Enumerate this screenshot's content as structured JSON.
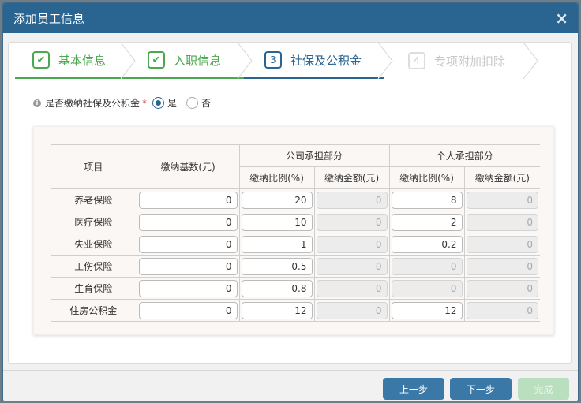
{
  "dialog": {
    "title": "添加员工信息",
    "close_glyph": "×"
  },
  "steps": [
    {
      "badge": "✔",
      "label": "基本信息",
      "state": "done"
    },
    {
      "badge": "✔",
      "label": "入职信息",
      "state": "done"
    },
    {
      "badge": "3",
      "label": "社保及公积金",
      "state": "active"
    },
    {
      "badge": "4",
      "label": "专项附加扣除",
      "state": "pending"
    }
  ],
  "question": {
    "info_glyph": "i",
    "text": "是否缴纳社保及公积金",
    "required_mark": "*",
    "options": [
      {
        "label": "是",
        "checked": true
      },
      {
        "label": "否",
        "checked": false
      }
    ]
  },
  "table": {
    "headers": {
      "item": "项目",
      "base": "缴纳基数(元)",
      "company_group": "公司承担部分",
      "personal_group": "个人承担部分",
      "company_rate": "缴纳比例(%)",
      "company_amount": "缴纳金额(元)",
      "personal_rate": "缴纳比例(%)",
      "personal_amount": "缴纳金额(元)"
    },
    "rows": [
      {
        "item": "养老保险",
        "base": "0",
        "company_rate": "20",
        "company_amount": "0",
        "personal_rate": "8",
        "personal_amount": "0",
        "personal_rate_readonly": false
      },
      {
        "item": "医疗保险",
        "base": "0",
        "company_rate": "10",
        "company_amount": "0",
        "personal_rate": "2",
        "personal_amount": "0",
        "personal_rate_readonly": false
      },
      {
        "item": "失业保险",
        "base": "0",
        "company_rate": "1",
        "company_amount": "0",
        "personal_rate": "0.2",
        "personal_amount": "0",
        "personal_rate_readonly": false
      },
      {
        "item": "工伤保险",
        "base": "0",
        "company_rate": "0.5",
        "company_amount": "0",
        "personal_rate": "0",
        "personal_amount": "0",
        "personal_rate_readonly": true
      },
      {
        "item": "生育保险",
        "base": "0",
        "company_rate": "0.8",
        "company_amount": "0",
        "personal_rate": "0",
        "personal_amount": "0",
        "personal_rate_readonly": true
      },
      {
        "item": "住房公积金",
        "base": "0",
        "company_rate": "12",
        "company_amount": "0",
        "personal_rate": "12",
        "personal_amount": "0",
        "personal_rate_readonly": false
      }
    ]
  },
  "footer": {
    "prev_label": "上一步",
    "next_label": "下一步",
    "finish_label": "完成"
  },
  "colors": {
    "primary": "#2a6592",
    "done": "#4aa84e",
    "finish_disabled": "#b9dfbf"
  }
}
